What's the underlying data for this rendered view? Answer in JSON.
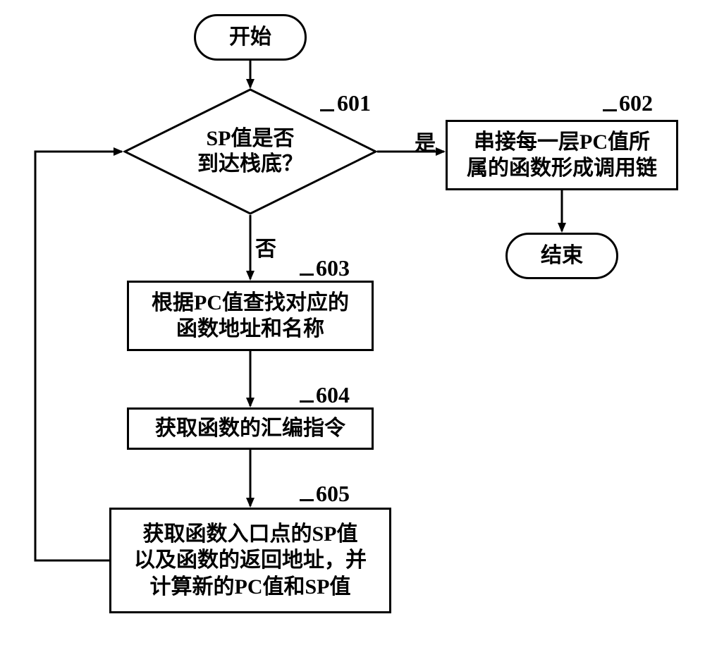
{
  "chart_data": {
    "type": "flowchart",
    "nodes": [
      {
        "id": "start",
        "type": "terminator",
        "label": "开始"
      },
      {
        "id": "d601",
        "type": "decision",
        "step": "601",
        "label": "SP值是否\n到达栈底？"
      },
      {
        "id": "p602",
        "type": "process",
        "step": "602",
        "label": "串接每一层PC值所\n属的函数形成调用链"
      },
      {
        "id": "p603",
        "type": "process",
        "step": "603",
        "label": "根据PC值查找对应的\n函数地址和名称"
      },
      {
        "id": "p604",
        "type": "process",
        "step": "604",
        "label": "获取函数的汇编指令"
      },
      {
        "id": "p605",
        "type": "process",
        "step": "605",
        "label": "获取函数入口点的SP值\n以及函数的返回地址，并\n计算新的PC值和SP值"
      },
      {
        "id": "end",
        "type": "terminator",
        "label": "结束"
      }
    ],
    "edges": [
      {
        "from": "start",
        "to": "d601"
      },
      {
        "from": "d601",
        "to": "p602",
        "label": "是"
      },
      {
        "from": "d601",
        "to": "p603",
        "label": "否"
      },
      {
        "from": "p603",
        "to": "p604"
      },
      {
        "from": "p604",
        "to": "p605"
      },
      {
        "from": "p605",
        "to": "d601"
      },
      {
        "from": "p602",
        "to": "end"
      }
    ]
  },
  "nodes": {
    "start": "开始",
    "end": "结束",
    "d601_l1": "SP值是否",
    "d601_l2": "到达栈底？",
    "p602_l1": "串接每一层PC值所",
    "p602_l2": "属的函数形成调用链",
    "p603_l1": "根据PC值查找对应的",
    "p603_l2": "函数地址和名称",
    "p604": "获取函数的汇编指令",
    "p605_l1": "获取函数入口点的SP值",
    "p605_l2": "以及函数的返回地址，并",
    "p605_l3": "计算新的PC值和SP值"
  },
  "steps": {
    "s601": "601",
    "s602": "602",
    "s603": "603",
    "s604": "604",
    "s605": "605"
  },
  "edge_labels": {
    "yes": "是",
    "no": "否"
  }
}
